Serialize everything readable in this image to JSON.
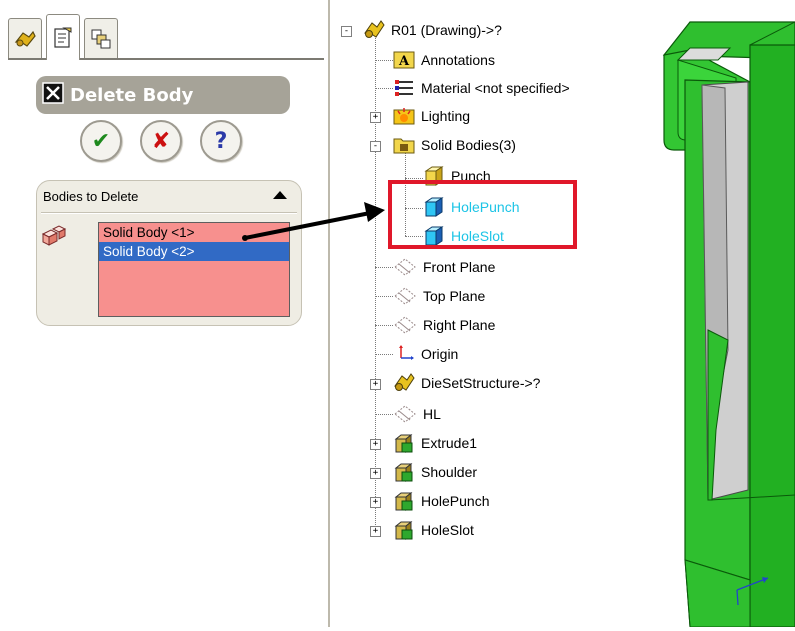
{
  "property_manager": {
    "title": "Delete Body",
    "tabs": [
      "feature-manager-tab",
      "property-manager-tab",
      "configuration-manager-tab"
    ],
    "actions": {
      "ok_symbol": "✔",
      "cancel_symbol": "✘",
      "help_symbol": "?"
    },
    "bodies_group": {
      "title": "Bodies to Delete",
      "items": [
        "Solid Body <1>",
        "Solid Body <2>"
      ],
      "selected_index": 1
    }
  },
  "feature_tree": {
    "root": "R01  (Drawing)->?",
    "items": [
      {
        "label": "Annotations",
        "icon": "annotations-icon"
      },
      {
        "label": "Material <not specified>",
        "icon": "material-icon"
      },
      {
        "label": "Lighting",
        "icon": "lighting-icon",
        "expand": "+"
      },
      {
        "label": "Solid Bodies(3)",
        "icon": "solid-bodies-folder-icon",
        "expand": "-"
      },
      {
        "label": "Punch",
        "icon": "solid-body-icon"
      },
      {
        "label": "HolePunch",
        "icon": "solid-body-icon",
        "highlight": true
      },
      {
        "label": "HoleSlot",
        "icon": "solid-body-icon",
        "highlight": true
      },
      {
        "label": "Front Plane",
        "icon": "plane-icon"
      },
      {
        "label": "Top Plane",
        "icon": "plane-icon"
      },
      {
        "label": "Right Plane",
        "icon": "plane-icon"
      },
      {
        "label": "Origin",
        "icon": "origin-icon"
      },
      {
        "label": "DieSetStructure->?",
        "icon": "part-icon",
        "expand": "+"
      },
      {
        "label": "HL",
        "icon": "plane-icon"
      },
      {
        "label": "Extrude1",
        "icon": "extrude-feature-icon",
        "expand": "+"
      },
      {
        "label": "Shoulder",
        "icon": "extrude-feature-icon",
        "expand": "+"
      },
      {
        "label": "HolePunch",
        "icon": "extrude-feature-icon",
        "expand": "+"
      },
      {
        "label": "HoleSlot",
        "icon": "extrude-feature-icon",
        "expand": "+"
      }
    ]
  },
  "colors": {
    "selection_list_bg": "#f7908e",
    "selected_row": "#316ac5",
    "highlight_box": "#e0182a",
    "highlight_text": "#1cc4e6",
    "model_green": "#1ec21e"
  }
}
